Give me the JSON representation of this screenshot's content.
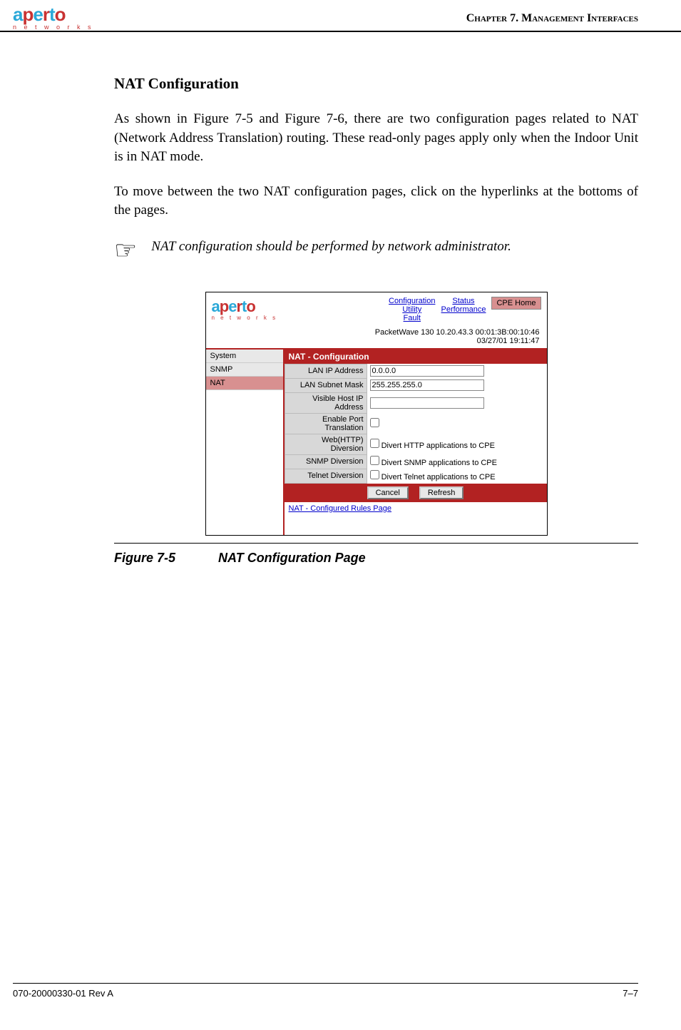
{
  "header": {
    "logo_main": "aperto",
    "logo_sub": "n e t w o r k s",
    "chapter": "Chapter 7.  Management Interfaces"
  },
  "section": {
    "title": "NAT Configuration",
    "para1": "As shown in Figure 7-5 and Figure 7-6, there are two configuration pages related to NAT (Network Address Translation) routing. These read-only pages apply only when the Indoor Unit is in NAT mode.",
    "para2": "To move between the two NAT configuration pages, click on the hyperlinks at the bottoms of the pages.",
    "note": "NAT configuration should be performed by network administrator."
  },
  "screenshot": {
    "logo_main": "aperto",
    "logo_sub": "n e t w o r k s",
    "nav": {
      "col1": [
        "Configuration",
        "Utility",
        "Fault"
      ],
      "col2": [
        "Status",
        "Performance"
      ],
      "cpe_home": "CPE Home"
    },
    "info_line1": "PacketWave 130    10.20.43.3    00:01:3B:00:10:46",
    "info_line2": "03/27/01    19:11:47",
    "sidebar": [
      {
        "label": "System",
        "active": false
      },
      {
        "label": "SNMP",
        "active": false
      },
      {
        "label": "NAT",
        "active": true
      }
    ],
    "panel_title": "NAT - Configuration",
    "fields": {
      "lan_ip_label": "LAN IP Address",
      "lan_ip_value": "0.0.0.0",
      "lan_mask_label": "LAN Subnet Mask",
      "lan_mask_value": "255.255.255.0",
      "visible_host_label": "Visible Host IP Address",
      "visible_host_value": "",
      "enable_port_label": "Enable Port Translation",
      "web_div_label": "Web(HTTP) Diversion",
      "web_div_text": "Divert HTTP applications to CPE",
      "snmp_div_label": "SNMP Diversion",
      "snmp_div_text": "Divert SNMP applications to CPE",
      "telnet_div_label": "Telnet Diversion",
      "telnet_div_text": "Divert Telnet applications to CPE"
    },
    "buttons": {
      "cancel": "Cancel",
      "refresh": "Refresh"
    },
    "rules_link": "NAT - Configured Rules Page"
  },
  "figure": {
    "number": "Figure 7-5",
    "title": "NAT Configuration Page"
  },
  "footer": {
    "doc_rev": "070-20000330-01 Rev A",
    "page_num": "7–7"
  }
}
